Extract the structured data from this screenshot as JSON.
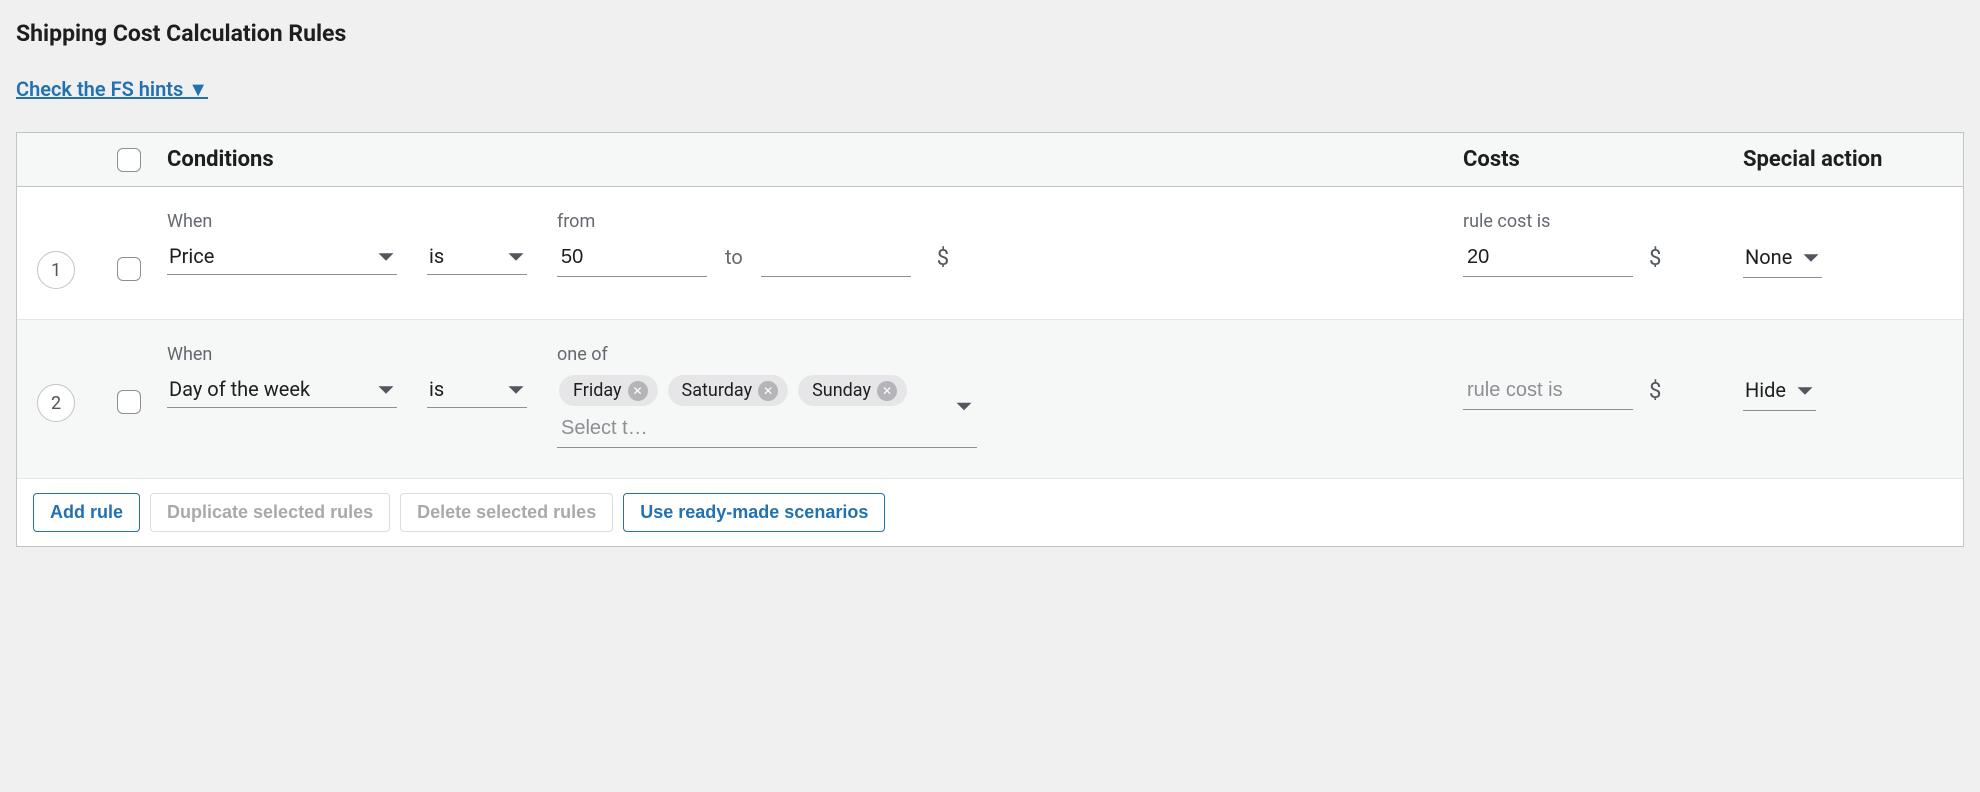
{
  "title": "Shipping Cost Calculation Rules",
  "hintsLinkText": "Check the FS hints ▼",
  "columns": {
    "conditions": "Conditions",
    "costs": "Costs",
    "action": "Special action"
  },
  "labels": {
    "when": "When",
    "from": "from",
    "to": "to",
    "oneOf": "one of",
    "ruleCostIs": "rule cost is",
    "currency": "$",
    "selectPlaceholder": "Select t…"
  },
  "rules": [
    {
      "index": "1",
      "whenSelect": "Price",
      "operator": "is",
      "fromValue": "50",
      "toValue": "",
      "costValue": "20",
      "action": "None"
    },
    {
      "index": "2",
      "whenSelect": "Day of the week",
      "operator": "is",
      "tags": [
        "Friday",
        "Saturday",
        "Sunday"
      ],
      "costPlaceholder": "rule cost is",
      "action": "Hide"
    }
  ],
  "footer": {
    "addRule": "Add rule",
    "duplicate": "Duplicate selected rules",
    "delete": "Delete selected rules",
    "scenarios": "Use ready-made scenarios"
  }
}
